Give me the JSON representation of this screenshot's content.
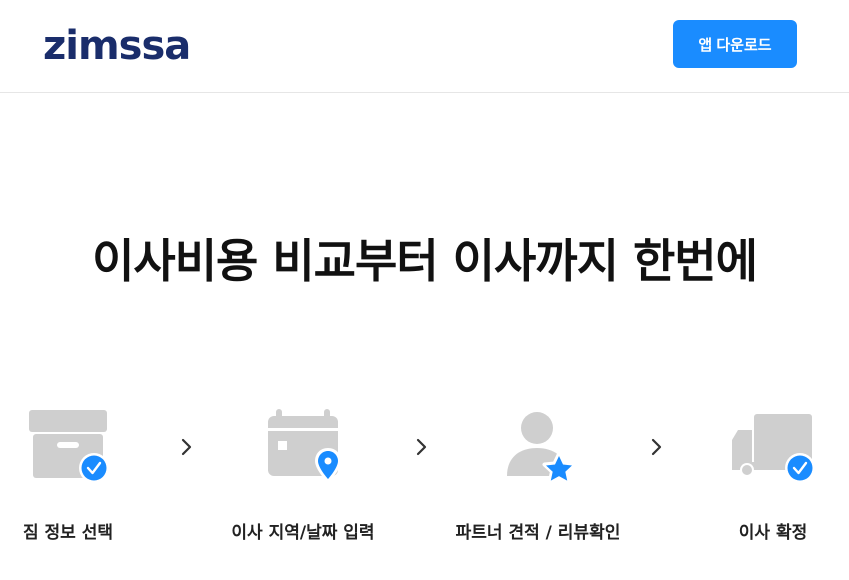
{
  "header": {
    "logo_text": "zimssa",
    "download_label": "앱 다운로드"
  },
  "main": {
    "headline": "이사비용 비교부터 이사까지 한번에"
  },
  "steps": [
    {
      "label": "짐 정보 선택",
      "icon": "box-check-icon"
    },
    {
      "label": "이사 지역/날짜 입력",
      "icon": "calendar-pin-icon"
    },
    {
      "label": "파트너 견적 / 리뷰확인",
      "icon": "person-star-icon"
    },
    {
      "label": "이사 확정",
      "icon": "truck-check-icon"
    }
  ],
  "colors": {
    "brand": "#1a2d6b",
    "accent": "#1a8cff",
    "icon_gray": "#cfcfcf"
  }
}
